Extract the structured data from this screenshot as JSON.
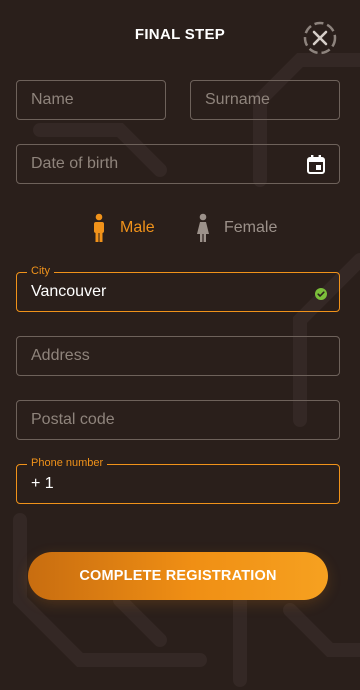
{
  "header": {
    "title": "FINAL STEP",
    "close_icon": "close-icon"
  },
  "form": {
    "name": {
      "placeholder": "Name"
    },
    "surname": {
      "placeholder": "Surname"
    },
    "dob": {
      "placeholder": "Date of birth",
      "icon": "calendar-icon"
    },
    "gender": {
      "male": {
        "label": "Male",
        "selected": true,
        "icon": "male-figure-icon"
      },
      "female": {
        "label": "Female",
        "selected": false,
        "icon": "female-figure-icon"
      }
    },
    "city": {
      "label": "City",
      "value": "Vancouver",
      "status_icon": "check-circle-icon"
    },
    "address": {
      "placeholder": "Address"
    },
    "postal": {
      "placeholder": "Postal code"
    },
    "phone": {
      "label": "Phone number",
      "value": "+ 1"
    }
  },
  "actions": {
    "submit_label": "COMPLETE REGISTRATION"
  },
  "colors": {
    "background": "#2a1f1b",
    "accent": "#f0921a",
    "border": "#6e625b",
    "valid": "#7bbf3a"
  }
}
